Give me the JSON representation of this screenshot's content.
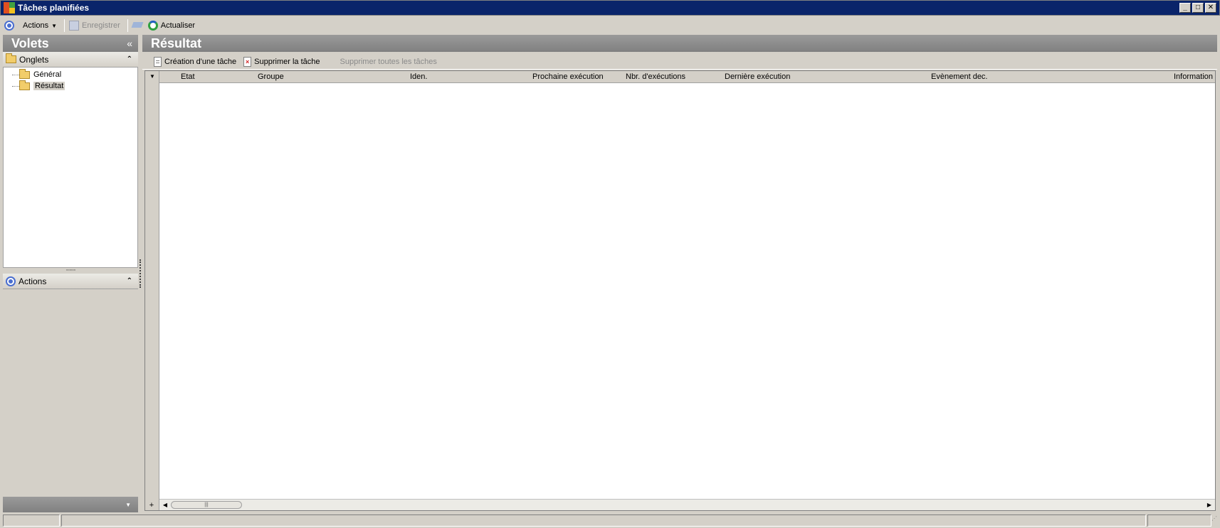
{
  "window": {
    "title": "Tâches planifiées",
    "btn_minimize": "_",
    "btn_maximize": "□",
    "btn_close": "✕"
  },
  "toolbar": {
    "actions_label": "Actions",
    "save_label": "Enregistrer",
    "refresh_label": "Actualiser"
  },
  "left_panel": {
    "title": "Volets",
    "collapse_glyph": "«",
    "tabs_section": {
      "label": "Onglets",
      "items": [
        {
          "label": "Général"
        },
        {
          "label": "Résultat"
        }
      ]
    },
    "actions_section": {
      "label": "Actions"
    },
    "grip_glyph": "∙∙∙∙∙∙∙∙∙∙∙",
    "chevron_up_glyph": "⌃",
    "bottom_glyph": "▼"
  },
  "main": {
    "title": "Résultat",
    "toolbar": {
      "create_label": "Création d'une tâche",
      "delete_label": "Supprimer la tâche",
      "delete_all_label": "Supprimer toutes les tâches"
    },
    "grid": {
      "columns": [
        "Etat",
        "Groupe",
        "Iden.",
        "Prochaine exécution",
        "Nbr. d'exécutions",
        "Dernière exécution",
        "Evènement dec.",
        "Information"
      ]
    },
    "scroll": {
      "plus_glyph": "+",
      "left_glyph": "◀",
      "right_glyph": "▶",
      "thumb_glyph": "|||"
    }
  },
  "colors": {
    "titlebar": "#0a246a",
    "panel_header": "#808080",
    "chrome": "#d4d0c8"
  }
}
